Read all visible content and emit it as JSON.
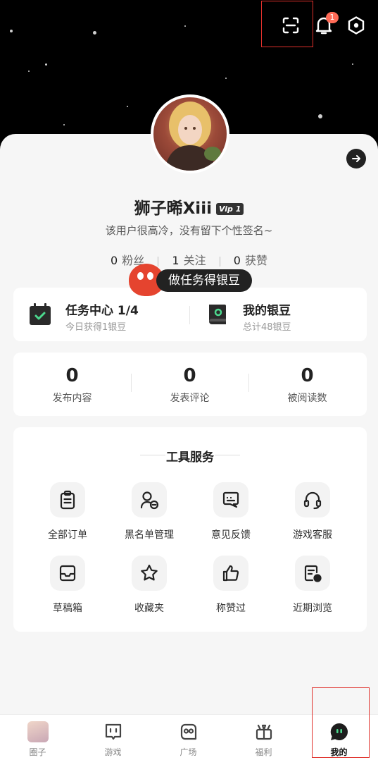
{
  "header": {
    "notification_count": "1"
  },
  "profile": {
    "username": "狮子晞Xiii",
    "vip_label": "Vip 1",
    "signature": "该用户很高冷，没有留下个性签名~",
    "followers_count": "0",
    "followers_label": "粉丝",
    "following_count": "1",
    "following_label": "关注",
    "likes_count": "0",
    "likes_label": "获赞",
    "task_bubble": "做任务得银豆"
  },
  "tasks": {
    "task_center_title": "任务中心",
    "task_center_progress": "1/4",
    "task_center_sub": "今日获得1银豆",
    "silver_title": "我的银豆",
    "silver_sub": "总计48银豆"
  },
  "stats": [
    {
      "value": "0",
      "label": "发布内容"
    },
    {
      "value": "0",
      "label": "发表评论"
    },
    {
      "value": "0",
      "label": "被阅读数"
    }
  ],
  "tools": {
    "title": "工具服务",
    "items": [
      {
        "label": "全部订单",
        "icon": "clipboard-icon"
      },
      {
        "label": "黑名单管理",
        "icon": "user-block-icon"
      },
      {
        "label": "意见反馈",
        "icon": "feedback-icon"
      },
      {
        "label": "游戏客服",
        "icon": "headset-icon"
      },
      {
        "label": "草稿箱",
        "icon": "inbox-icon"
      },
      {
        "label": "收藏夹",
        "icon": "star-icon"
      },
      {
        "label": "称赞过",
        "icon": "thumbs-up-icon"
      },
      {
        "label": "近期浏览",
        "icon": "history-icon"
      }
    ]
  },
  "tabbar": {
    "items": [
      {
        "label": "圈子"
      },
      {
        "label": "游戏"
      },
      {
        "label": "广场"
      },
      {
        "label": "福利"
      },
      {
        "label": "我的"
      }
    ],
    "active": "我的"
  }
}
